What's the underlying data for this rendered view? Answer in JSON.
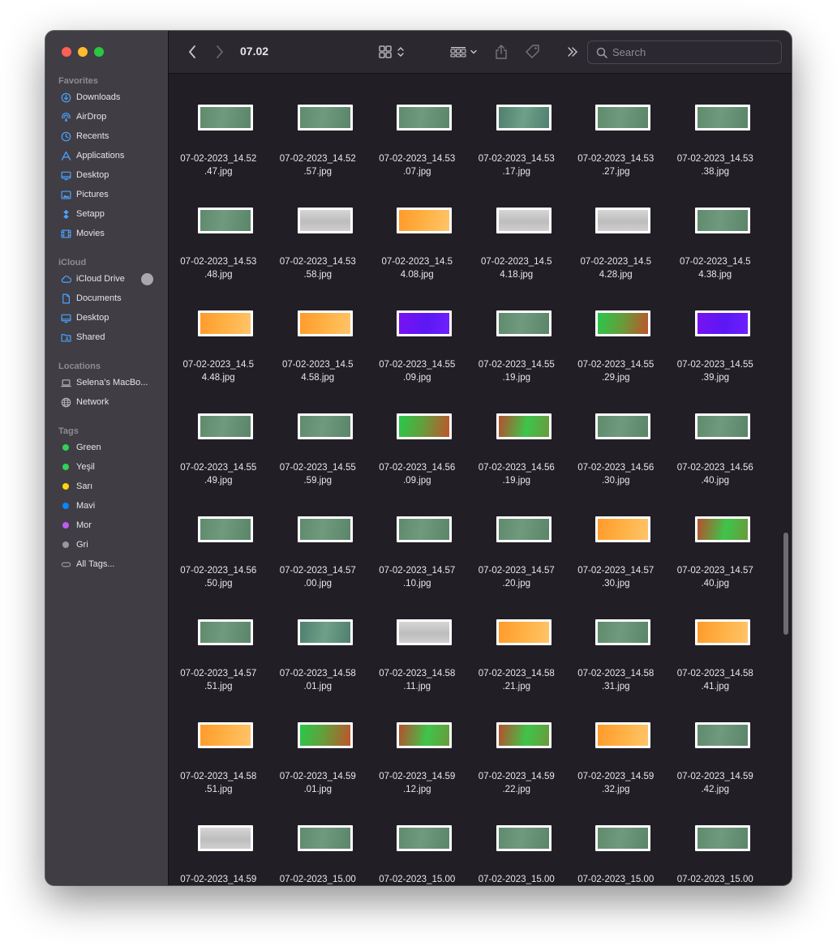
{
  "window": {
    "title": "07.02"
  },
  "toolbar": {
    "back_icon": "chevron-left-icon",
    "forward_icon": "chevron-right-icon",
    "view_icon": "grid-view-icon",
    "group_icon": "group-by-icon",
    "share_icon": "share-icon",
    "tag_icon": "tag-icon",
    "more_icon": "chevron-double-right-icon",
    "search_placeholder": "Search"
  },
  "sidebar": {
    "favorites_label": "Favorites",
    "favorites": [
      {
        "label": "Downloads",
        "icon": "download-icon"
      },
      {
        "label": "AirDrop",
        "icon": "airdrop-icon"
      },
      {
        "label": "Recents",
        "icon": "clock-icon"
      },
      {
        "label": "Applications",
        "icon": "applications-icon"
      },
      {
        "label": "Desktop",
        "icon": "desktop-icon"
      },
      {
        "label": "Pictures",
        "icon": "pictures-icon"
      },
      {
        "label": "Setapp",
        "icon": "setapp-icon"
      },
      {
        "label": "Movies",
        "icon": "film-icon"
      }
    ],
    "icloud_label": "iCloud",
    "icloud": [
      {
        "label": "iCloud Drive",
        "icon": "cloud-icon"
      },
      {
        "label": "Documents",
        "icon": "document-icon"
      },
      {
        "label": "Desktop",
        "icon": "desktop-icon"
      },
      {
        "label": "Shared",
        "icon": "shared-folder-icon"
      }
    ],
    "locations_label": "Locations",
    "locations": [
      {
        "label": "Selena’s MacBo...",
        "icon": "laptop-icon"
      },
      {
        "label": "Network",
        "icon": "network-icon"
      }
    ],
    "tags_label": "Tags",
    "tags": [
      {
        "label": "Green",
        "color": "#30d158"
      },
      {
        "label": "Yeşil",
        "color": "#30d158"
      },
      {
        "label": "Sarı",
        "color": "#ffd60a"
      },
      {
        "label": "Mavi",
        "color": "#0a84ff"
      },
      {
        "label": "Mor",
        "color": "#bf5af2"
      },
      {
        "label": "Gri",
        "color": "#98989d"
      },
      {
        "label": "All Tags...",
        "color": ""
      }
    ]
  },
  "files": [
    {
      "name": "07-02-2023_14.52\n.47.jpg",
      "thumb": "green"
    },
    {
      "name": "07-02-2023_14.52\n.57.jpg",
      "thumb": "green"
    },
    {
      "name": "07-02-2023_14.53\n.07.jpg",
      "thumb": "green"
    },
    {
      "name": "07-02-2023_14.53\n.17.jpg",
      "thumb": "teal"
    },
    {
      "name": "07-02-2023_14.53\n.27.jpg",
      "thumb": "green"
    },
    {
      "name": "07-02-2023_14.53\n.38.jpg",
      "thumb": "green"
    },
    {
      "name": "07-02-2023_14.53\n.48.jpg",
      "thumb": "green"
    },
    {
      "name": "07-02-2023_14.53\n.58.jpg",
      "thumb": "gray"
    },
    {
      "name": "07-02-2023_14.5\n4.08.jpg",
      "thumb": "orange"
    },
    {
      "name": "07-02-2023_14.5\n4.18.jpg",
      "thumb": "gray"
    },
    {
      "name": "07-02-2023_14.5\n4.28.jpg",
      "thumb": "gray"
    },
    {
      "name": "07-02-2023_14.5\n4.38.jpg",
      "thumb": "green"
    },
    {
      "name": "07-02-2023_14.5\n4.48.jpg",
      "thumb": "orange"
    },
    {
      "name": "07-02-2023_14.5\n4.58.jpg",
      "thumb": "orange"
    },
    {
      "name": "07-02-2023_14.55\n.09.jpg",
      "thumb": "purple"
    },
    {
      "name": "07-02-2023_14.55\n.19.jpg",
      "thumb": "green"
    },
    {
      "name": "07-02-2023_14.55\n.29.jpg",
      "thumb": "greenred"
    },
    {
      "name": "07-02-2023_14.55\n.39.jpg",
      "thumb": "purple"
    },
    {
      "name": "07-02-2023_14.55\n.49.jpg",
      "thumb": "green"
    },
    {
      "name": "07-02-2023_14.55\n.59.jpg",
      "thumb": "green"
    },
    {
      "name": "07-02-2023_14.56\n.09.jpg",
      "thumb": "greenred"
    },
    {
      "name": "07-02-2023_14.56\n.19.jpg",
      "thumb": "redgreen"
    },
    {
      "name": "07-02-2023_14.56\n.30.jpg",
      "thumb": "green"
    },
    {
      "name": "07-02-2023_14.56\n.40.jpg",
      "thumb": "green"
    },
    {
      "name": "07-02-2023_14.56\n.50.jpg",
      "thumb": "green"
    },
    {
      "name": "07-02-2023_14.57\n.00.jpg",
      "thumb": "green"
    },
    {
      "name": "07-02-2023_14.57\n.10.jpg",
      "thumb": "green"
    },
    {
      "name": "07-02-2023_14.57\n.20.jpg",
      "thumb": "green"
    },
    {
      "name": "07-02-2023_14.57\n.30.jpg",
      "thumb": "orange"
    },
    {
      "name": "07-02-2023_14.57\n.40.jpg",
      "thumb": "redgreen"
    },
    {
      "name": "07-02-2023_14.57\n.51.jpg",
      "thumb": "green"
    },
    {
      "name": "07-02-2023_14.58\n.01.jpg",
      "thumb": "teal"
    },
    {
      "name": "07-02-2023_14.58\n.11.jpg",
      "thumb": "gray"
    },
    {
      "name": "07-02-2023_14.58\n.21.jpg",
      "thumb": "orange"
    },
    {
      "name": "07-02-2023_14.58\n.31.jpg",
      "thumb": "green"
    },
    {
      "name": "07-02-2023_14.58\n.41.jpg",
      "thumb": "orange"
    },
    {
      "name": "07-02-2023_14.58\n.51.jpg",
      "thumb": "orange"
    },
    {
      "name": "07-02-2023_14.59\n.01.jpg",
      "thumb": "greenred"
    },
    {
      "name": "07-02-2023_14.59\n.12.jpg",
      "thumb": "redgreen"
    },
    {
      "name": "07-02-2023_14.59\n.22.jpg",
      "thumb": "redgreen"
    },
    {
      "name": "07-02-2023_14.59\n.32.jpg",
      "thumb": "orange"
    },
    {
      "name": "07-02-2023_14.59\n.42.jpg",
      "thumb": "green"
    },
    {
      "name": "07-02-2023_14.59",
      "thumb": "gray"
    },
    {
      "name": "07-02-2023_15.00",
      "thumb": "green"
    },
    {
      "name": "07-02-2023_15.00",
      "thumb": "green"
    },
    {
      "name": "07-02-2023_15.00",
      "thumb": "green"
    },
    {
      "name": "07-02-2023_15.00",
      "thumb": "green"
    },
    {
      "name": "07-02-2023_15.00",
      "thumb": "green"
    }
  ],
  "thumb_colors": {
    "green": "linear-gradient(100deg,#5f8a6c 0%,#6f9a7e 45%,#5b8569 100%)",
    "teal": "linear-gradient(100deg,#4f7f6e 0%,#6fa088 50%,#4f7f70 100%)",
    "gray": "linear-gradient(180deg,#d6d6d6 0%,#bdbdbd 55%,#cfcfcf 100%)",
    "orange": "linear-gradient(100deg,#ff9a2b 0%,#ffb347 55%,#ffc46a 100%)",
    "purple": "linear-gradient(100deg,#7a12f0 0%,#5a18f5 55%,#7020ff 100%)",
    "greenred": "linear-gradient(100deg,#28c94a 0%,#6a9a3a 50%,#c0542a 100%)",
    "redgreen": "linear-gradient(100deg,#b5502e 0%,#3fc44a 55%,#6a9a3c 100%)"
  }
}
